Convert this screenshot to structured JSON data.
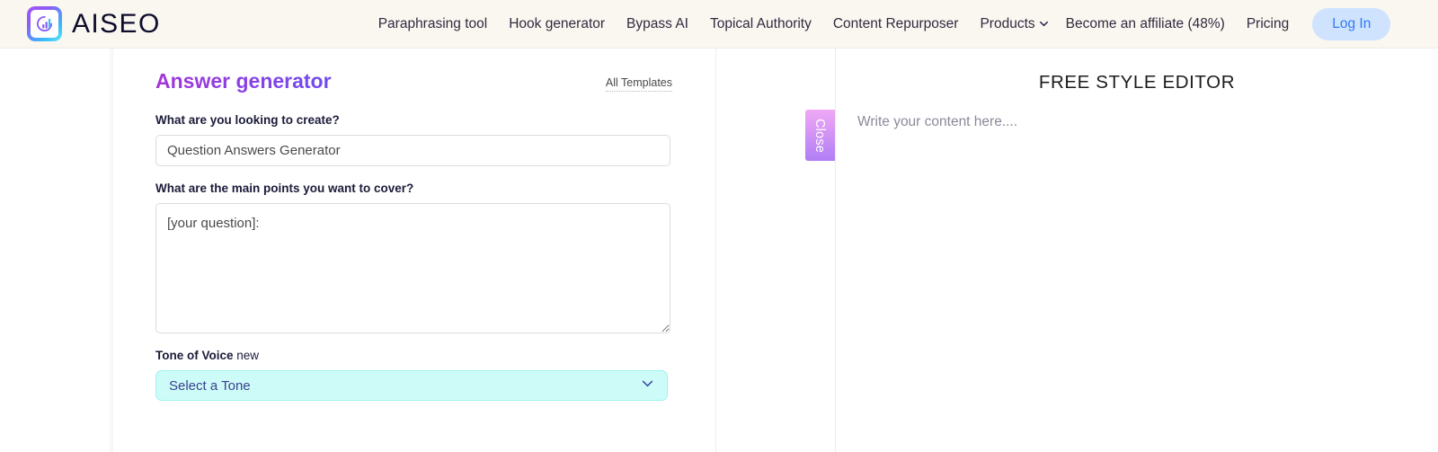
{
  "navbar": {
    "brand_name": "AISEO",
    "logo_icon": "aiseo-bar-chart-logo-icon",
    "links": [
      {
        "label": "Paraphrasing tool",
        "icon": null
      },
      {
        "label": "Hook generator",
        "icon": null
      },
      {
        "label": "Bypass AI",
        "icon": null
      },
      {
        "label": "Topical Authority",
        "icon": null
      },
      {
        "label": "Content Repurposer",
        "icon": null
      },
      {
        "label": "Products",
        "icon": "chevron-down-icon"
      },
      {
        "label": "Become an affiliate (48%)",
        "icon": null
      },
      {
        "label": "Pricing",
        "icon": null
      }
    ],
    "login_label": "Log In",
    "colors": {
      "background": "#faf7f0",
      "link_text": "#2f2a3f",
      "login_bg": "#cfe3ff",
      "login_text": "#2f7bf6"
    }
  },
  "form_panel": {
    "title": "Answer generator",
    "all_templates_label": "All Templates",
    "fields": {
      "create": {
        "label": "What are you looking to create?",
        "value": "Question Answers Generator",
        "placeholder": "Question Answers Generator"
      },
      "main_points": {
        "label": "What are the main points you want to cover?",
        "value": "[your question]:",
        "placeholder": "[your question]:"
      },
      "tone": {
        "label": "Tone of Voice",
        "badge": "new",
        "selected": "Select a Tone",
        "chevron_icon": "chevron-down-icon"
      }
    },
    "colors": {
      "title_gradient_start": "#a435d6",
      "title_gradient_end": "#6f4df0",
      "tone_select_bg": "#cdfcf8",
      "tone_select_border": "#9ef2ec",
      "tone_select_text": "#3b3f8f"
    }
  },
  "close_handle": {
    "label": "Close",
    "gradient_start": "#f0a8f5",
    "gradient_end": "#b07ef5"
  },
  "editor_panel": {
    "title": "FREE STYLE EDITOR",
    "placeholder": "Write your content here....",
    "content": ""
  }
}
